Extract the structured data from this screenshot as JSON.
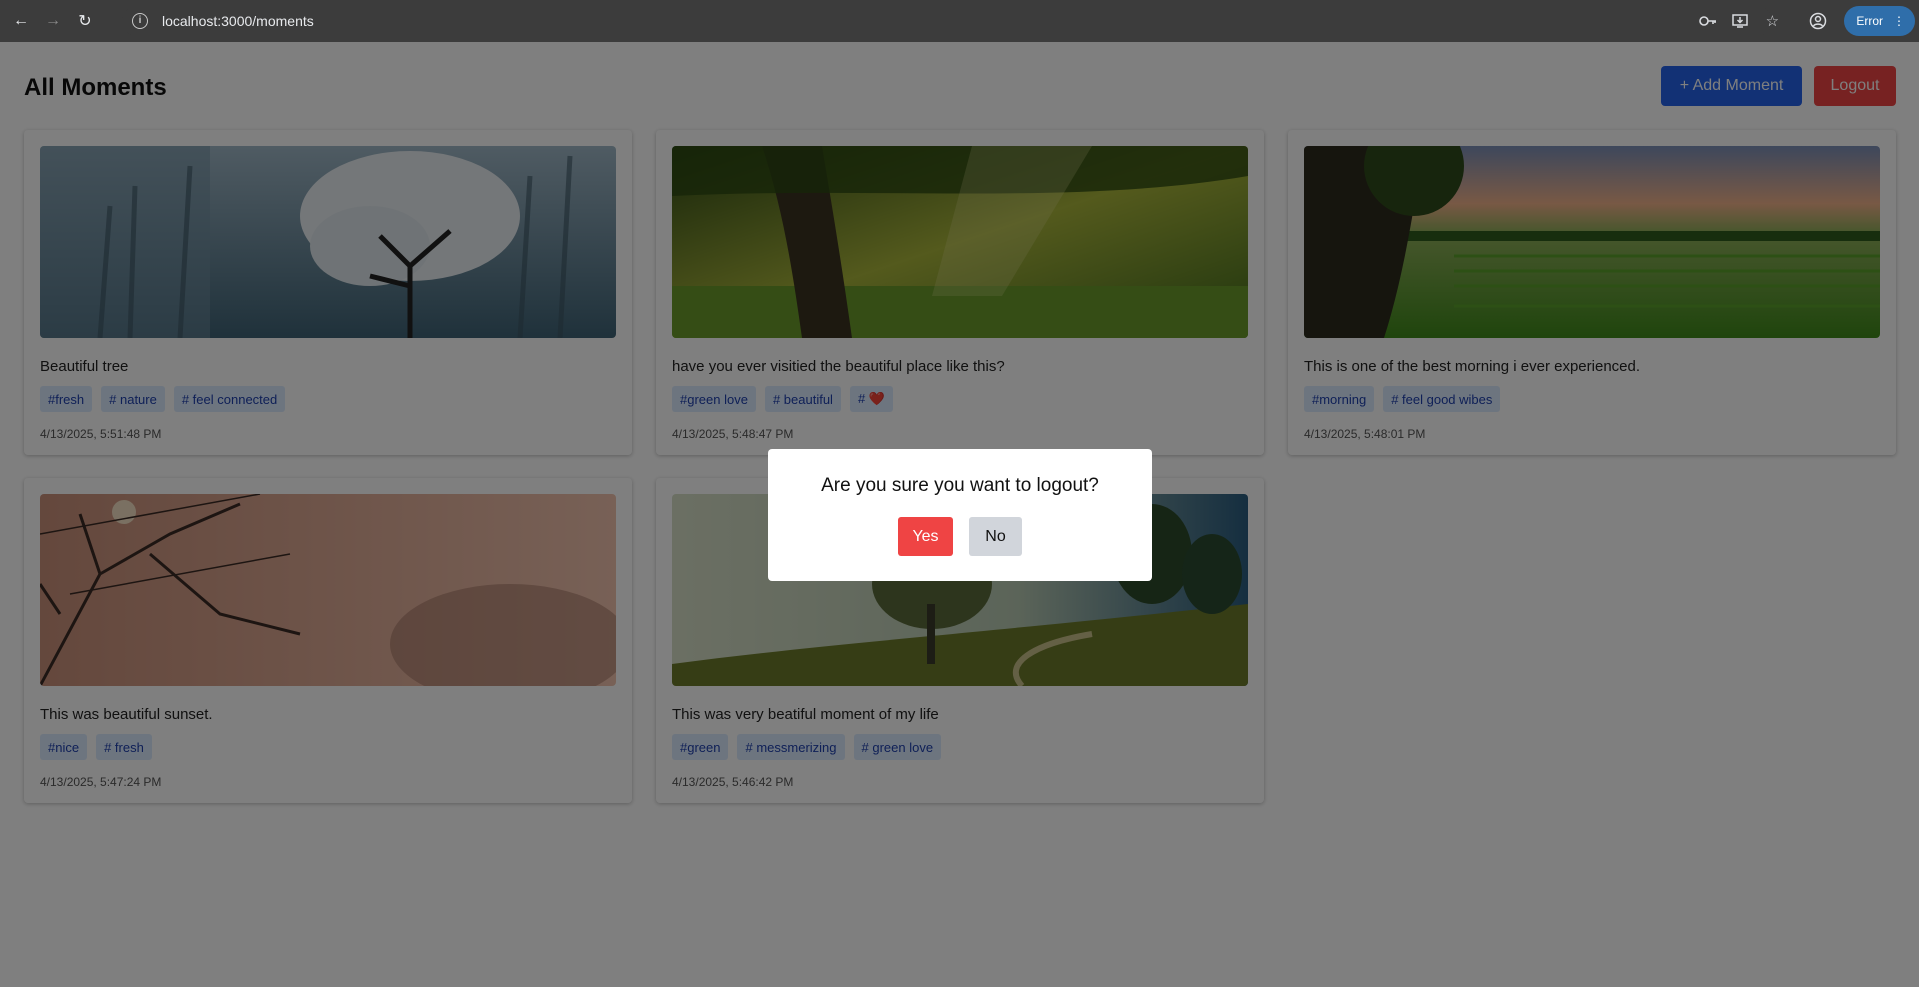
{
  "browser": {
    "url": "localhost:3000/moments",
    "profile_label": "Error"
  },
  "page": {
    "title": "All Moments",
    "add_button": "+ Add Moment",
    "logout_button": "Logout"
  },
  "moments": [
    {
      "caption": "Beautiful tree",
      "tags": [
        "#fresh",
        "# nature",
        "# feel connected"
      ],
      "date": "4/13/2025, 5:51:48 PM",
      "image": "misty-tree-with-white-blossoms"
    },
    {
      "caption": "have you ever visitied the beautiful place like this?",
      "tags": [
        "#green love",
        "# beautiful",
        "# ❤️"
      ],
      "date": "4/13/2025, 5:48:47 PM",
      "image": "sunlit-green-forest"
    },
    {
      "caption": "This is one of the best morning i ever experienced.",
      "tags": [
        "#morning",
        "# feel good wibes"
      ],
      "date": "4/13/2025, 5:48:01 PM",
      "image": "rice-terraces-at-sunrise"
    },
    {
      "caption": "This was beautiful sunset.",
      "tags": [
        "#nice",
        "# fresh"
      ],
      "date": "4/13/2025, 5:47:24 PM",
      "image": "foggy-sunset-bare-trees"
    },
    {
      "caption": "This was very beatiful moment of my life",
      "tags": [
        "#green",
        "# messmerizing",
        "# green love"
      ],
      "date": "4/13/2025, 5:46:42 PM",
      "image": "misty-meadow-with-trees"
    }
  ],
  "dialog": {
    "message": "Are you sure you want to logout?",
    "yes": "Yes",
    "no": "No"
  },
  "colors": {
    "primary": "#2563eb",
    "danger": "#ef4444",
    "tag_bg": "#dbeafe",
    "tag_text": "#1e40af"
  }
}
